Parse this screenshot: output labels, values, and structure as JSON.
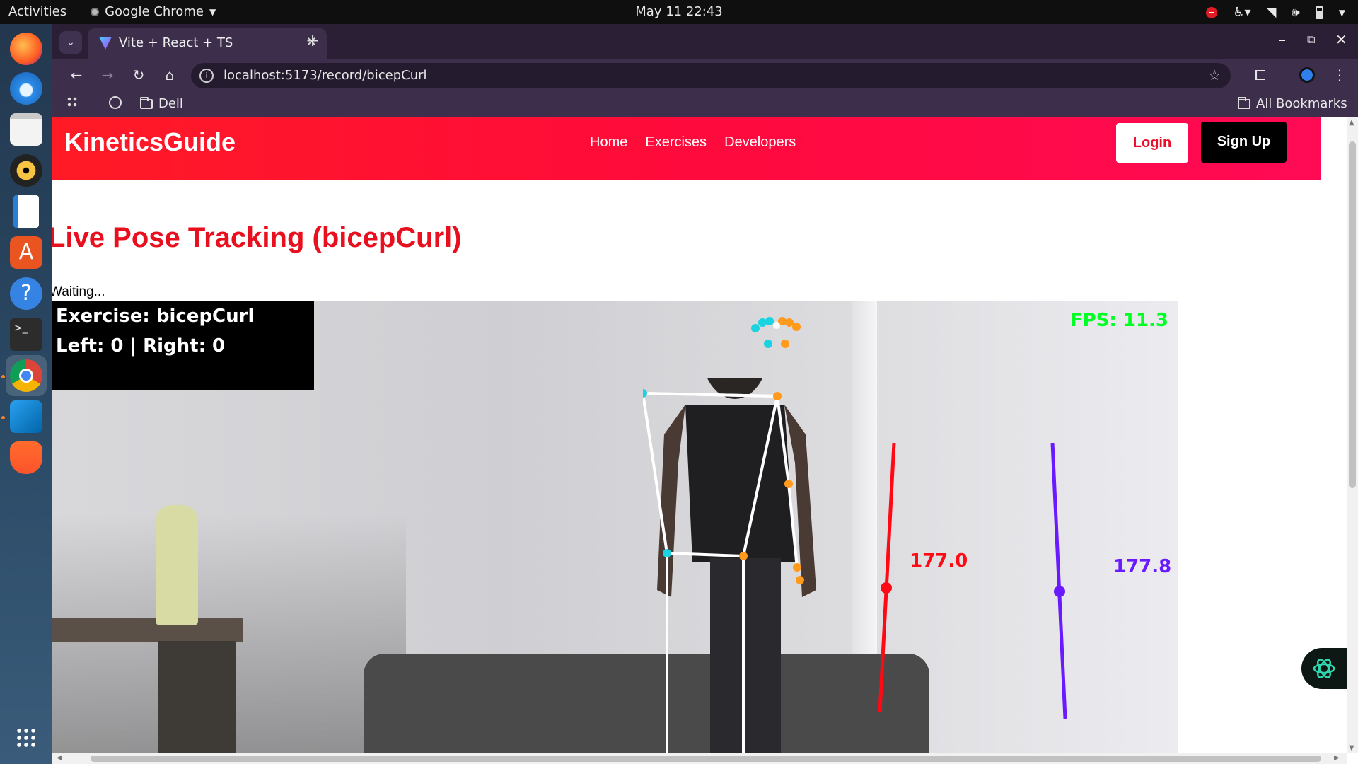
{
  "system_bar": {
    "activities": "Activities",
    "app_name": "Google Chrome",
    "clock": "May 11  22:43"
  },
  "browser": {
    "tab_title": "Vite + React + TS",
    "url": "localhost:5173/record/bicepCurl",
    "bookmarks": {
      "dell": "Dell",
      "all_bookmarks": "All Bookmarks"
    }
  },
  "site": {
    "brand": "KineticsGuide",
    "nav": [
      "Home",
      "Exercises",
      "Developers"
    ],
    "login_label": "Login",
    "signup_label": "Sign Up"
  },
  "page": {
    "heading": "Live Pose Tracking (bicepCurl)",
    "status": "Waiting..."
  },
  "video_overlay": {
    "exercise_line": "Exercise: bicepCurl",
    "count_line": "Left: 0 | Right: 0",
    "fps": "FPS: 11.3",
    "left_angle": "177.0",
    "right_angle": "177.8",
    "left_arm_color": "#ff0a14",
    "right_arm_color": "#6a1aff"
  },
  "colors": {
    "navbar_accent": "#ff0a3c",
    "heading": "#e8101f",
    "fps": "#00ff22"
  }
}
